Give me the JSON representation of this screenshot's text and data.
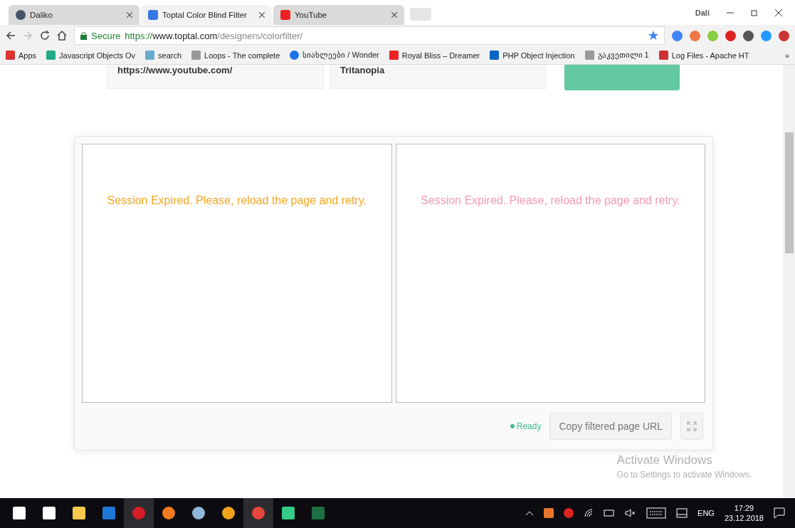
{
  "tabs": [
    {
      "title": "Daliko",
      "selected": false
    },
    {
      "title": "Toptal Color Blind Filter",
      "selected": true
    },
    {
      "title": "YouTube",
      "selected": false
    }
  ],
  "profile": "Dali",
  "address": {
    "secure_label": "Secure",
    "scheme": "https://",
    "host": "www.toptal.com",
    "path": "/designers/colorfilter/"
  },
  "bookmarks": [
    {
      "label": "Apps"
    },
    {
      "label": "Javascript Objects Ov"
    },
    {
      "label": "search"
    },
    {
      "label": "Loops - The complete"
    },
    {
      "label": "სიახლეები / Wonder"
    },
    {
      "label": "Royal Bliss – Dreamer"
    },
    {
      "label": "PHP Object Injection"
    },
    {
      "label": "გაკვეთილი 1"
    },
    {
      "label": "Log Files - Apache HT"
    }
  ],
  "bookmarks_more": "»",
  "form": {
    "url_value": "https://www.youtube.com/",
    "filter_value": "Tritanopia"
  },
  "panels": [
    {
      "message": "Session Expired. Please, reload the page and retry.",
      "color": "#f5a623"
    },
    {
      "message": "Session Expired. Please, reload the page and retry.",
      "color": "#f49ab3"
    }
  ],
  "status": {
    "label": "Ready",
    "color": "#3fbf8a"
  },
  "copy_button": "Copy filtered page URL",
  "activation": {
    "title": "Activate Windows",
    "subtitle": "Go to Settings to activate Windows."
  },
  "taskbar": {
    "language": "ENG",
    "time": "17:29",
    "date": "23.12.2018"
  }
}
